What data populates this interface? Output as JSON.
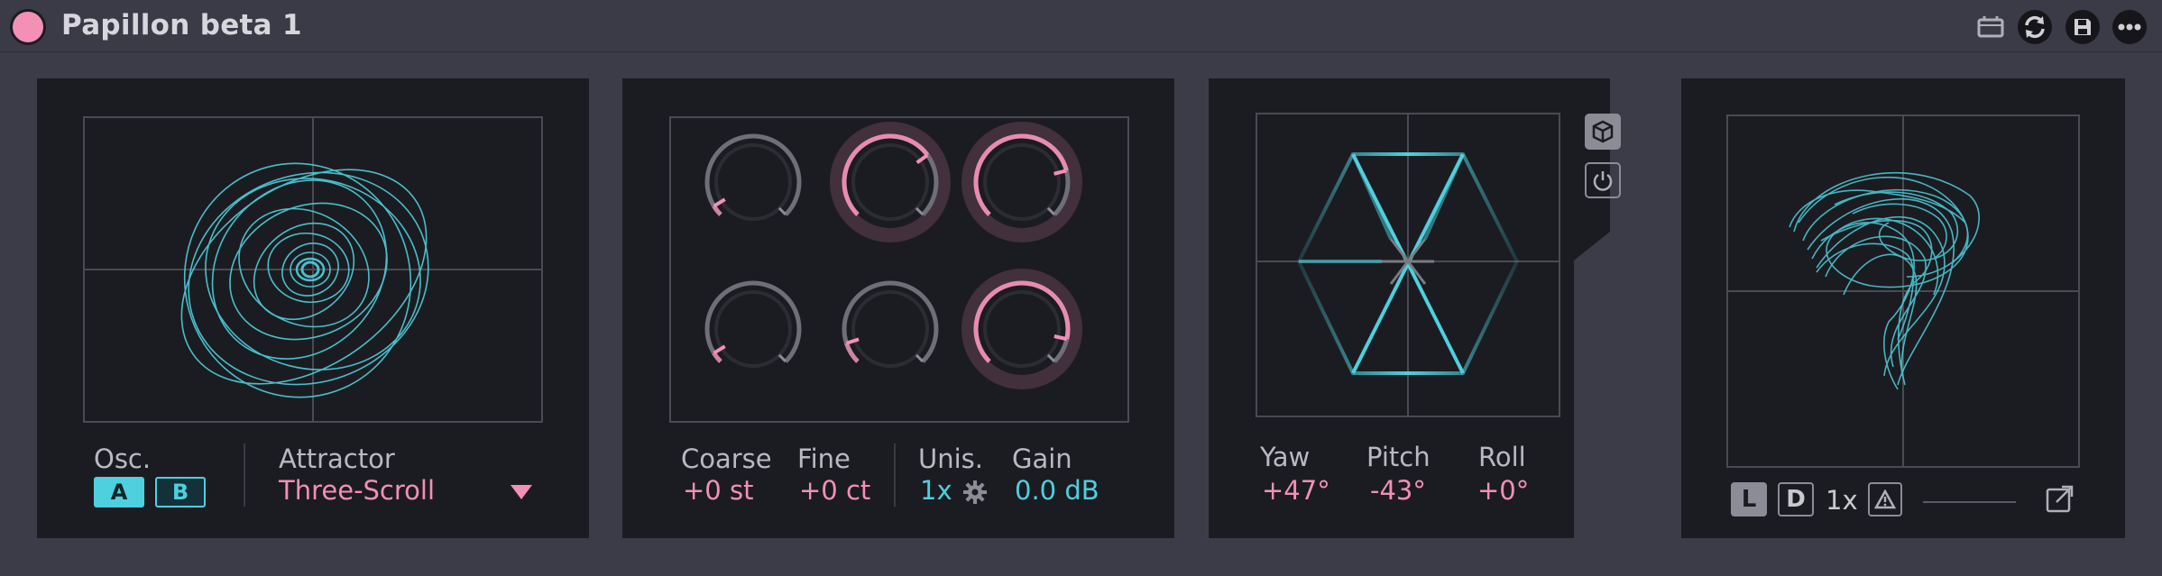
{
  "window": {
    "title": "Papillon beta 1"
  },
  "titlebar_icons": [
    "device-icon",
    "sync-icon",
    "save-icon",
    "more-icon"
  ],
  "oscillator": {
    "label": "Osc.",
    "buttons": [
      "A",
      "B"
    ],
    "active": "A",
    "attractor_label": "Attractor",
    "attractor_value": "Three-Scroll"
  },
  "tuning": {
    "knobs": [
      {
        "row": 1,
        "col": 1,
        "value": 0.05,
        "active": false
      },
      {
        "row": 1,
        "col": 2,
        "value": 0.7,
        "active": true
      },
      {
        "row": 1,
        "col": 3,
        "value": 0.78,
        "active": true
      },
      {
        "row": 2,
        "col": 1,
        "value": 0.05,
        "active": false
      },
      {
        "row": 2,
        "col": 2,
        "value": 0.1,
        "active": false
      },
      {
        "row": 2,
        "col": 3,
        "value": 0.88,
        "active": true
      }
    ],
    "coarse_label": "Coarse",
    "coarse_value": "+0 st",
    "fine_label": "Fine",
    "fine_value": "+0 ct",
    "unison_label": "Unis.",
    "unison_value": "1x",
    "gain_label": "Gain",
    "gain_value": "0.0 dB"
  },
  "rotation": {
    "yaw_label": "Yaw",
    "yaw_value": "+47°",
    "pitch_label": "Pitch",
    "pitch_value": "-43°",
    "roll_label": "Roll",
    "roll_value": "+0°",
    "mode_icons": [
      "cube-icon",
      "power-icon"
    ]
  },
  "output": {
    "l_label": "L",
    "d_label": "D",
    "zoom_value": "1x",
    "icons": [
      "warning-icon",
      "external-link-icon"
    ]
  },
  "colors": {
    "accent_pink": "#f48fb6",
    "accent_cyan": "#4ed0de",
    "panel_bg": "#1b1c21",
    "device_bg": "#3c3c48"
  }
}
